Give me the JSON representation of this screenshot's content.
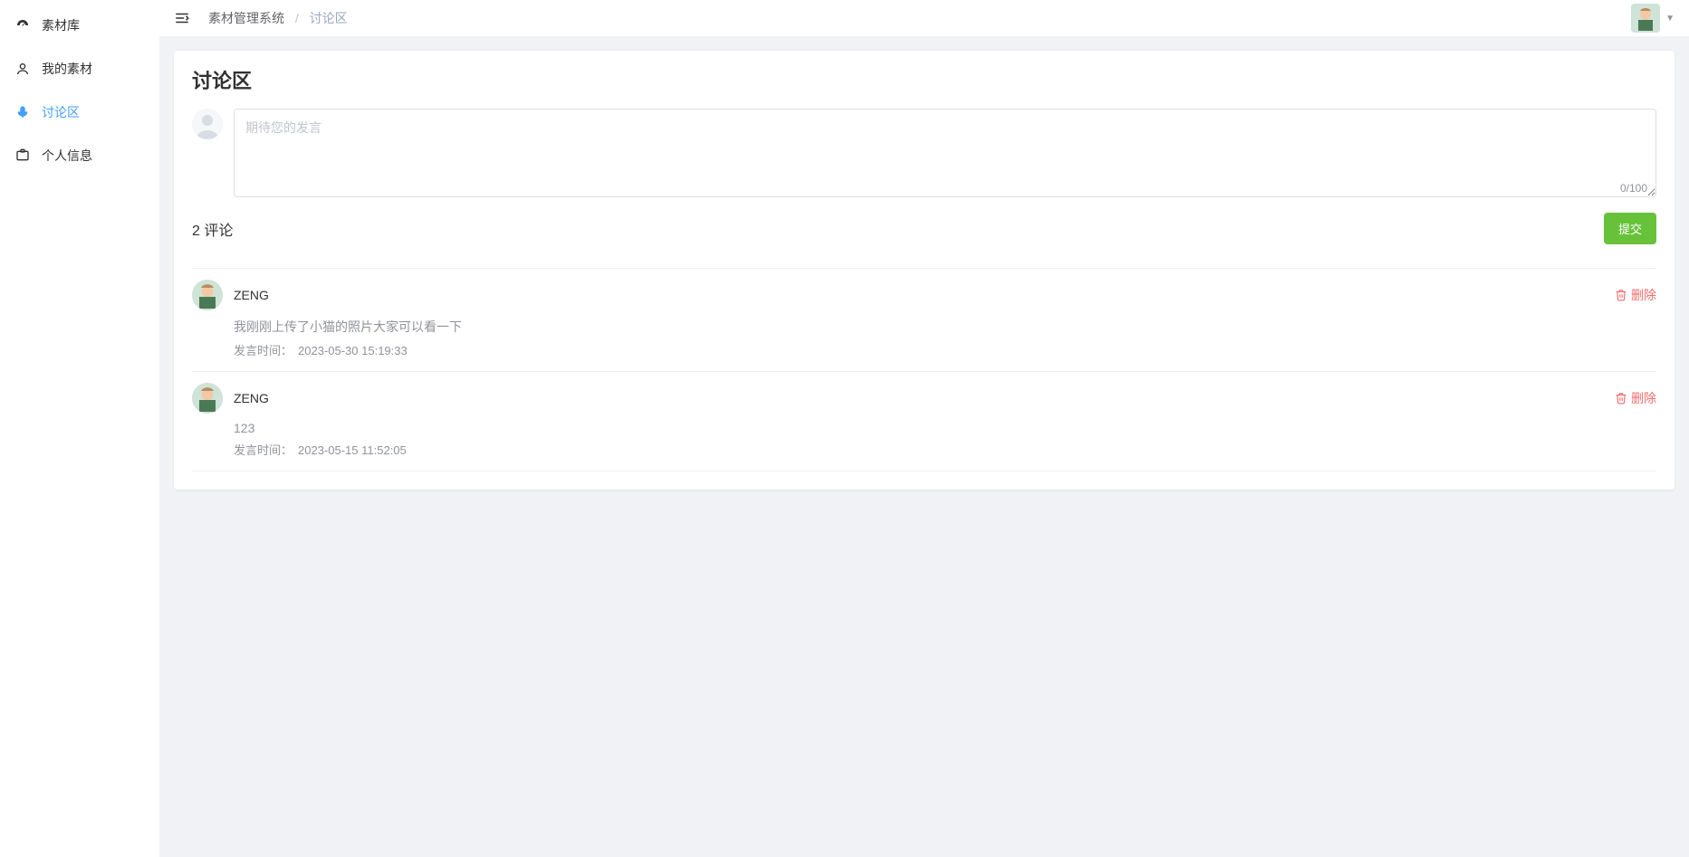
{
  "sidebar": {
    "items": [
      {
        "label": "素材库"
      },
      {
        "label": "我的素材"
      },
      {
        "label": "讨论区"
      },
      {
        "label": "个人信息"
      }
    ]
  },
  "breadcrumb": {
    "root": "素材管理系统",
    "current": "讨论区"
  },
  "page": {
    "title": "讨论区",
    "placeholder": "期待您的发言",
    "char_count": "0/100",
    "comment_count_label": "2 评论",
    "submit_label": "提交",
    "time_label": "发言时间：",
    "delete_label": "删除"
  },
  "comments": [
    {
      "author": "ZENG",
      "text": "我刚刚上传了小猫的照片大家可以看一下",
      "time": "2023-05-30 15:19:33"
    },
    {
      "author": "ZENG",
      "text": "123",
      "time": "2023-05-15 11:52:05"
    }
  ]
}
